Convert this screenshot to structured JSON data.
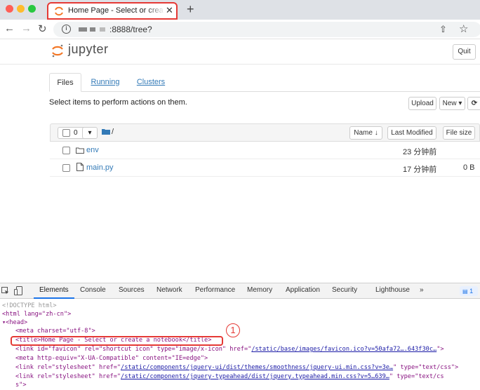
{
  "browser": {
    "tab_title": "Home Page - Select or create a notebook",
    "tab_close": "✕",
    "new_tab": "+",
    "url": ":8888/tree?",
    "back": "←",
    "forward": "→",
    "reload": "↻",
    "share": "⇧",
    "bookmark": "☆"
  },
  "jupyter": {
    "logo_text": "jupyter",
    "quit_label": "Quit",
    "tabs": [
      {
        "label": "Files",
        "active": true
      },
      {
        "label": "Running",
        "active": false
      },
      {
        "label": "Clusters",
        "active": false
      }
    ],
    "select_message": "Select items to perform actions on them.",
    "upload_label": "Upload",
    "new_label": "New ▾",
    "refresh_icon": "⟳",
    "list_header": {
      "count": "0",
      "dropdown": "▾",
      "path": "/",
      "sort_name": "Name ↓",
      "last_modified": "Last Modified",
      "file_size": "File size"
    },
    "files": [
      {
        "name": "env",
        "type": "folder",
        "modified": "23 分钟前",
        "size": ""
      },
      {
        "name": "main.py",
        "type": "file",
        "modified": "17 分钟前",
        "size": "0 B"
      }
    ]
  },
  "devtools": {
    "tabs": [
      "Elements",
      "Console",
      "Sources",
      "Network",
      "Performance",
      "Memory",
      "Application",
      "Security",
      "Lighthouse",
      "»"
    ],
    "active_tab": "Elements",
    "badge": "1",
    "annotation": "1",
    "lines": {
      "doctype": "<!DOCTYPE html>",
      "html_open": "<html lang=\"zh-cn\">",
      "head_open": "▾<head>",
      "meta_charset": "<meta charset=\"utf-8\">",
      "title": "<title>Home Page - Select or create a notebook</title>",
      "link_favicon_1": "<link id=\"favicon\" rel=\"shortcut icon\" type=\"image/x-icon\" href=\"",
      "link_favicon_href": "/static/base/images/favicon.ico?v=50afa72….643f30c…",
      "link_favicon_end": "\">",
      "meta_xua": "<meta http-equiv=\"X-UA-Compatible\" content=\"IE=edge\">",
      "link_css1_a": "<link rel=\"stylesheet\" href=\"",
      "link_css1_href": "/static/components/jquery-ui/dist/themes/smoothness/jquery-ui.min.css?v=3e…",
      "link_css1_end": "\" type=\"text/css\">",
      "link_css2_a": "<link rel=\"stylesheet\" href=\"",
      "link_css2_href": "/static/components/jquery-typeahead/dist/jquery.typeahead.min.css?v=5…639…",
      "link_css2_end": "\" type=\"text/cs",
      "link_css2_wrap": "s\">"
    }
  }
}
